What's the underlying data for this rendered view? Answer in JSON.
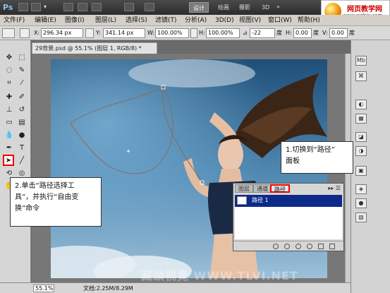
{
  "titlebar": {
    "app_logo": "Ps",
    "workspaces": [
      "设计",
      "绘画",
      "摄影",
      "3D"
    ],
    "active_workspace": "设计",
    "watermark_line1": "网页教学网",
    "watermark_line2": "www.webjx.com"
  },
  "menubar": {
    "items": [
      "文件(F)",
      "编辑(E)",
      "图像(I)",
      "图层(L)",
      "选择(S)",
      "滤镜(T)",
      "分析(A)",
      "3D(D)",
      "视图(V)",
      "窗口(W)",
      "帮助(H)"
    ]
  },
  "options": {
    "x_label": "X:",
    "x_value": "296.34 px",
    "y_label": "Y:",
    "y_value": "341.14 px",
    "w_label": "W:",
    "w_value": "100.00%",
    "h_label": "H:",
    "h_value": "100.00%",
    "angle_value": "-22",
    "angle_unit": "度",
    "hskew_label": "H:",
    "hskew_value": "0.00",
    "hskew_unit": "度",
    "vskew_label": "V:",
    "vskew_value": "0.00",
    "vskew_unit": "度"
  },
  "document": {
    "tab_title": "29背景.psd @ 55.1% (图层 1, RGB/8) *",
    "zoom": "55.1%",
    "doc_size": "文档:2.25M/8.29M",
    "photo_watermark": "藏頭視覺 WWW.TLVI.NET"
  },
  "paths_panel": {
    "tabs": [
      "图层",
      "通道",
      "路径"
    ],
    "active_tab": "路径",
    "menu_glyph": "▸▸ ☰",
    "rows": [
      "路径 1"
    ]
  },
  "callouts": {
    "step1_line1": "1.切换到“路径”",
    "step1_line2": "面板",
    "step2_line1": "2.单击“路径选择工",
    "step2_line2": "具”，并执行“自由变",
    "step2_line3": "换”命令"
  },
  "colors": {
    "highlight_red": "#e00000",
    "selection_blue": "#0c2a8a"
  }
}
